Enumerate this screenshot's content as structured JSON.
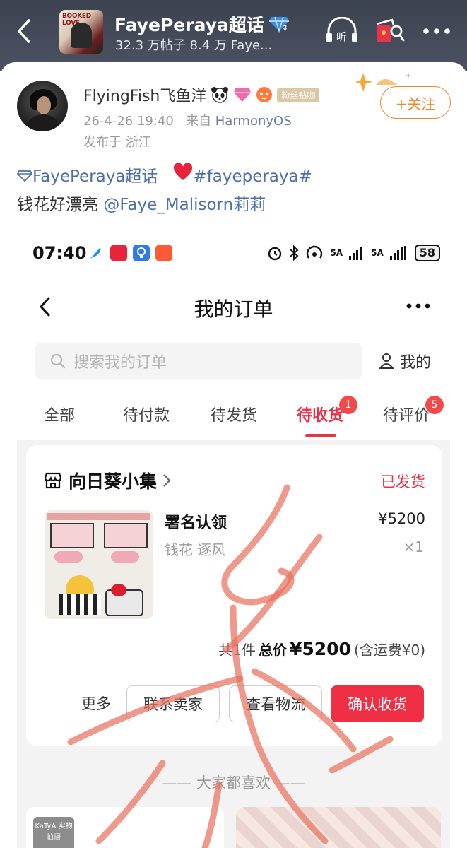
{
  "header": {
    "topic_name": "FayePeraya超话",
    "topic_stats": "32.3 万帖子 8.4 万 Faye...",
    "listen_label": "听",
    "cover_text": "BOOKED LOVE"
  },
  "post": {
    "username": "FlyingFish飞鱼洋",
    "fan_badge": "粉丝钻咖",
    "timestamp": "26-4-26 19:40",
    "source_prefix": "来自",
    "source": "HarmonyOS",
    "location": "发布于 浙江",
    "follow_label": "+关注",
    "topic_link": "FayePeraya超话",
    "hashtag": "#fayeperaya#",
    "body_text": "钱花好漂亮",
    "mention": "@Faye_Malisorn莉莉"
  },
  "screenshot": {
    "status": {
      "time": "07:40",
      "battery": "58",
      "signal_labels": [
        "5A",
        "5A"
      ]
    },
    "nav_title": "我的订单",
    "search_placeholder": "搜索我的订单",
    "mine_label": "我的",
    "tabs": [
      {
        "label": "全部"
      },
      {
        "label": "待付款"
      },
      {
        "label": "待发货"
      },
      {
        "label": "待收货",
        "badge": "1"
      },
      {
        "label": "待评价",
        "badge": "5"
      }
    ],
    "order": {
      "shop_name": "向日葵小集",
      "status": "已发货",
      "product_name": "署名认领",
      "product_spec": "钱花 逐风",
      "price": "¥5200",
      "quantity": "×1",
      "count_label": "共1件",
      "total_label": "总价",
      "total_amount": "¥5200",
      "shipping_note": "(含运费¥0)",
      "more_label": "更多",
      "contact_label": "联系卖家",
      "logistics_label": "查看物流",
      "confirm_label": "确认收货"
    },
    "recommend_title": "—— 大家都喜欢 ——",
    "katya_label": "KaTyA 实物拍摄"
  },
  "colors": {
    "accent_red": "#e8314a",
    "follow_orange": "#f08a2c",
    "link_blue": "#4d6fa8",
    "header_bg": "#3b4250"
  }
}
